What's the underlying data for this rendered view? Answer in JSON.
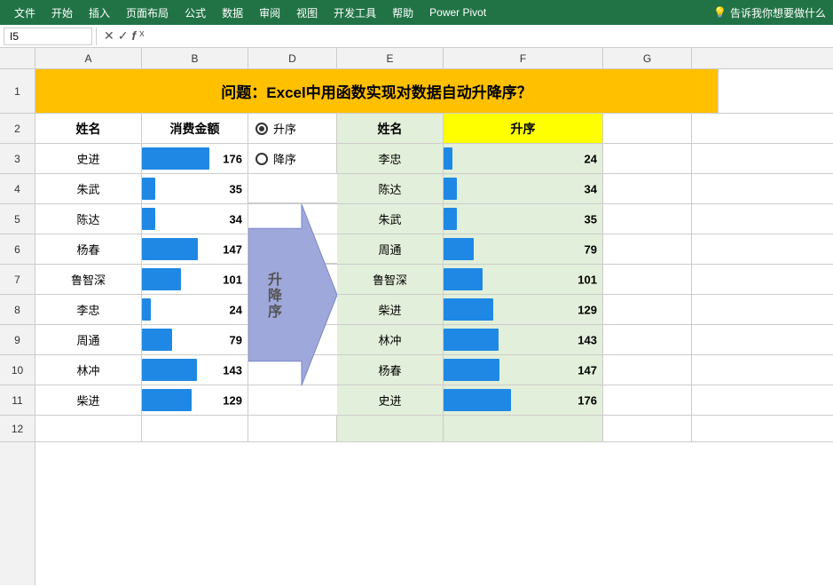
{
  "menubar": {
    "items": [
      "文件",
      "开始",
      "插入",
      "页面布局",
      "公式",
      "数据",
      "审阅",
      "视图",
      "开发工具",
      "帮助",
      "Power Pivot"
    ],
    "search_placeholder": "告诉我你想要做什么"
  },
  "formulabar": {
    "cell_ref": "I5",
    "formula": ""
  },
  "title": "问题：Excel中用函数实现对数据自动升降序？",
  "col_headers": [
    "A",
    "B",
    "",
    "D",
    "E",
    "F",
    "G"
  ],
  "row_numbers": [
    "1",
    "2",
    "3",
    "4",
    "5",
    "6",
    "7",
    "8",
    "9",
    "10",
    "11",
    "12"
  ],
  "header_row": {
    "name_label": "姓名",
    "amount_label": "消费金额",
    "radio_asc": "升序",
    "radio_desc": "降序",
    "result_name": "姓名",
    "result_order": "升序"
  },
  "source_data": [
    {
      "name": "史进",
      "value": 176
    },
    {
      "name": "朱武",
      "value": 35
    },
    {
      "name": "陈达",
      "value": 34
    },
    {
      "name": "杨春",
      "value": 147
    },
    {
      "name": "鲁智深",
      "value": 101
    },
    {
      "name": "李忠",
      "value": 24
    },
    {
      "name": "周通",
      "value": 79
    },
    {
      "name": "林冲",
      "value": 143
    },
    {
      "name": "柴进",
      "value": 129
    }
  ],
  "sorted_data": [
    {
      "name": "李忠",
      "value": 24
    },
    {
      "name": "陈达",
      "value": 34
    },
    {
      "name": "朱武",
      "value": 35
    },
    {
      "name": "周通",
      "value": 79
    },
    {
      "name": "鲁智深",
      "value": 101
    },
    {
      "name": "柴进",
      "value": 129
    },
    {
      "name": "林冲",
      "value": 143
    },
    {
      "name": "杨春",
      "value": 147
    },
    {
      "name": "史进",
      "value": 176
    }
  ],
  "max_value": 176,
  "arrow_text": "升\n降\n序",
  "colors": {
    "bar": "#1F88E5",
    "title_bg": "#FFC000",
    "header_yellow": "#FFFF00",
    "light_green": "#E2EFDA",
    "arrow_fill": "#9FA8DA",
    "menu_green": "#217346"
  }
}
